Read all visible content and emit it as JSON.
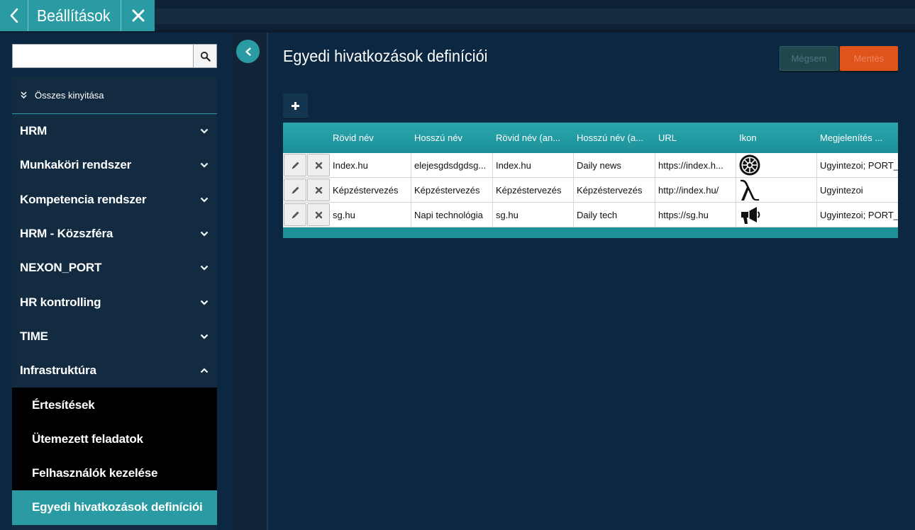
{
  "window": {
    "title": "Beállítások"
  },
  "search": {
    "value": "",
    "placeholder": ""
  },
  "sidebar": {
    "expand_all_label": "Összes kinyitása",
    "items": [
      {
        "label": "HRM",
        "expanded": false
      },
      {
        "label": "Munkaköri rendszer",
        "expanded": false
      },
      {
        "label": "Kompetencia rendszer",
        "expanded": false
      },
      {
        "label": "HRM - Közszféra",
        "expanded": false
      },
      {
        "label": "NEXON_PORT",
        "expanded": false
      },
      {
        "label": "HR kontrolling",
        "expanded": false
      },
      {
        "label": "TIME",
        "expanded": false
      },
      {
        "label": "Infrastruktúra",
        "expanded": true
      }
    ],
    "sub_items": [
      {
        "label": "Értesítések",
        "active": false
      },
      {
        "label": "Ütemezett feladatok",
        "active": false
      },
      {
        "label": "Felhasználók kezelése",
        "active": false
      },
      {
        "label": "Egyedi hivatkozások definíciói",
        "active": true
      }
    ]
  },
  "main": {
    "title": "Egyedi hivatkozások definíciói",
    "cancel_label": "Mégsem",
    "save_label": "Mentés",
    "add_icon": "plus-icon"
  },
  "grid": {
    "columns": [
      "Rövid név",
      "Hosszú név",
      "Rövid név (an...",
      "Hosszú név (a...",
      "URL",
      "Ikon",
      "Megjelenítés ..."
    ],
    "rows": [
      {
        "short_name": "Index.hu",
        "long_name": "elejesgdsdgdsg...",
        "short_name_en": "Index.hu",
        "long_name_en": "Daily news",
        "url": "https://index.h...",
        "icon": "empire-icon",
        "display": "Ugyintezoi; PORT_"
      },
      {
        "short_name": "Képzéstervezés",
        "long_name": "Képzéstervezés",
        "short_name_en": "Képzéstervezés",
        "long_name_en": "Képzéstervezés",
        "url": "http://index.hu/",
        "icon": "lambda-icon",
        "display": "Ugyintezoi"
      },
      {
        "short_name": "sg.hu",
        "long_name": "Napi technológia",
        "short_name_en": "sg.hu",
        "long_name_en": "Daily tech",
        "url": "https://sg.hu",
        "icon": "megaphone-icon",
        "display": "Ugyintezoi; PORT_"
      }
    ]
  },
  "colors": {
    "accent": "#2a9ba3",
    "background": "#0b2741",
    "save": "#e0531a",
    "cancel": "#20474d"
  }
}
